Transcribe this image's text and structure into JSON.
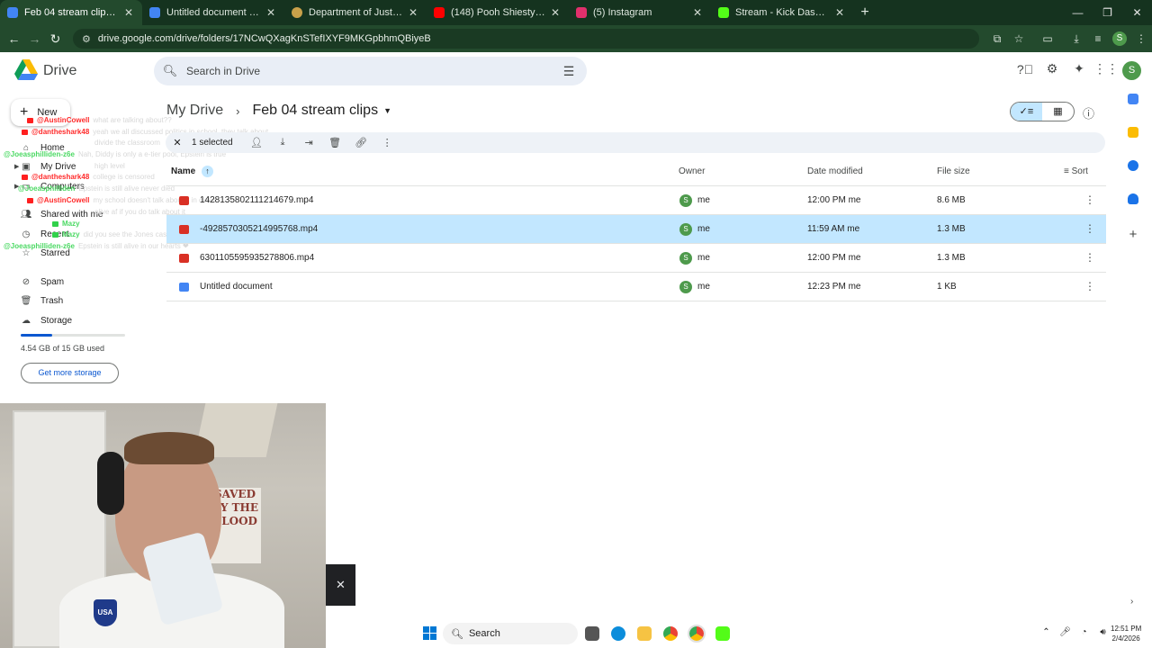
{
  "browser": {
    "tabs": [
      {
        "title": "Feb 04 stream clips - Google D",
        "color": "#4285f4",
        "active": true
      },
      {
        "title": "Untitled document - Google D",
        "color": "#4285f4",
        "active": false
      },
      {
        "title": "Department of Justice | Epstein",
        "color": "#c9a14a",
        "active": false
      },
      {
        "title": "(148) Pooh Shiesty - FDO [Offic",
        "color": "#ff0000",
        "active": false
      },
      {
        "title": "(5) Instagram",
        "color": "#e1306c",
        "active": false
      },
      {
        "title": "Stream - Kick Dashboard",
        "color": "#53fc18",
        "active": false
      }
    ],
    "url": "drive.google.com/drive/folders/17NCwQXagKnSTefIXYF9MKGpbhmQBiyeB",
    "profile_initial": "S"
  },
  "drive": {
    "app_name": "Drive",
    "search_placeholder": "Search in Drive",
    "account_initial": "S",
    "new_label": "New",
    "nav": {
      "home": "Home",
      "my_drive": "My Drive",
      "computers": "Computers",
      "shared": "Shared with me",
      "recent": "Recent",
      "starred": "Starred",
      "spam": "Spam",
      "trash": "Trash",
      "storage": "Storage"
    },
    "storage_used": "4.54 GB of 15 GB used",
    "storage_fraction": 0.3,
    "get_more_storage": "Get more storage",
    "breadcrumb_root": "My Drive",
    "breadcrumb_current": "Feb 04 stream clips",
    "selected_text": "1 selected",
    "columns": {
      "name": "Name",
      "owner": "Owner",
      "date": "Date modified",
      "size": "File size",
      "sort": "Sort"
    },
    "files": [
      {
        "name": "1428135802111214679.mp4",
        "type": "video",
        "owner": "me",
        "owner_initial": "S",
        "date": "12:00 PM me",
        "size": "8.6 MB",
        "selected": false
      },
      {
        "name": "-4928570305214995768.mp4",
        "type": "video",
        "owner": "me",
        "owner_initial": "S",
        "date": "11:59 AM me",
        "size": "1.3 MB",
        "selected": true
      },
      {
        "name": "6301105595935278806.mp4",
        "type": "video",
        "owner": "me",
        "owner_initial": "S",
        "date": "12:00 PM me",
        "size": "1.3 MB",
        "selected": false
      },
      {
        "name": "Untitled document",
        "type": "doc",
        "owner": "me",
        "owner_initial": "S",
        "date": "12:23 PM me",
        "size": "1 KB",
        "selected": false
      }
    ]
  },
  "chat": [
    {
      "user": "@AustinCowell",
      "color": "#ff2b2b",
      "badge": "red",
      "msg": "what are talking about??"
    },
    {
      "user": "@dantheshark48",
      "color": "#ff2b2b",
      "badge": "red",
      "msg": "yeah we all discussed politics in school, they talk about"
    },
    {
      "user": "",
      "color": "#ffffff",
      "badge": "none",
      "msg": "divide the classroom"
    },
    {
      "user": "@Joeasphilliden-z6e",
      "color": "#4cd964",
      "badge": "none",
      "msg": "Nah, Diddy is only a e-tier pool, Epstein is true"
    },
    {
      "user": "",
      "color": "#ffffff",
      "badge": "none",
      "msg": "high level"
    },
    {
      "user": "@dantheshark48",
      "color": "#ff2b2b",
      "badge": "red",
      "msg": "college is censored"
    },
    {
      "user": "@Joeasphilliden",
      "color": "#4cd964",
      "badge": "none",
      "msg": "Epstein is still alive never died"
    },
    {
      "user": "@AustinCowell",
      "color": "#ff2b2b",
      "badge": "red",
      "msg": "my school doesn't talk about it in class"
    },
    {
      "user": "",
      "color": "#ffffff",
      "badge": "none",
      "msg": "alive af if you do talk about it"
    },
    {
      "user": "Mazy",
      "color": "#4cd964",
      "badge": "green",
      "msg": ""
    },
    {
      "user": "Mazy",
      "color": "#4cd964",
      "badge": "green",
      "msg": "did you see the Jones case"
    },
    {
      "user": "@Joeasphilliden-z6e",
      "color": "#4cd964",
      "badge": "none",
      "msg": "Epstein is still alive in our hearts ❤"
    }
  ],
  "webcam": {
    "shirt_text": [
      "SAVED",
      "BY THE",
      "BLOOD"
    ],
    "badge_text": "USA"
  },
  "taskbar": {
    "search_label": "Search",
    "time": "12:51 PM",
    "date": "2/4/2026"
  }
}
